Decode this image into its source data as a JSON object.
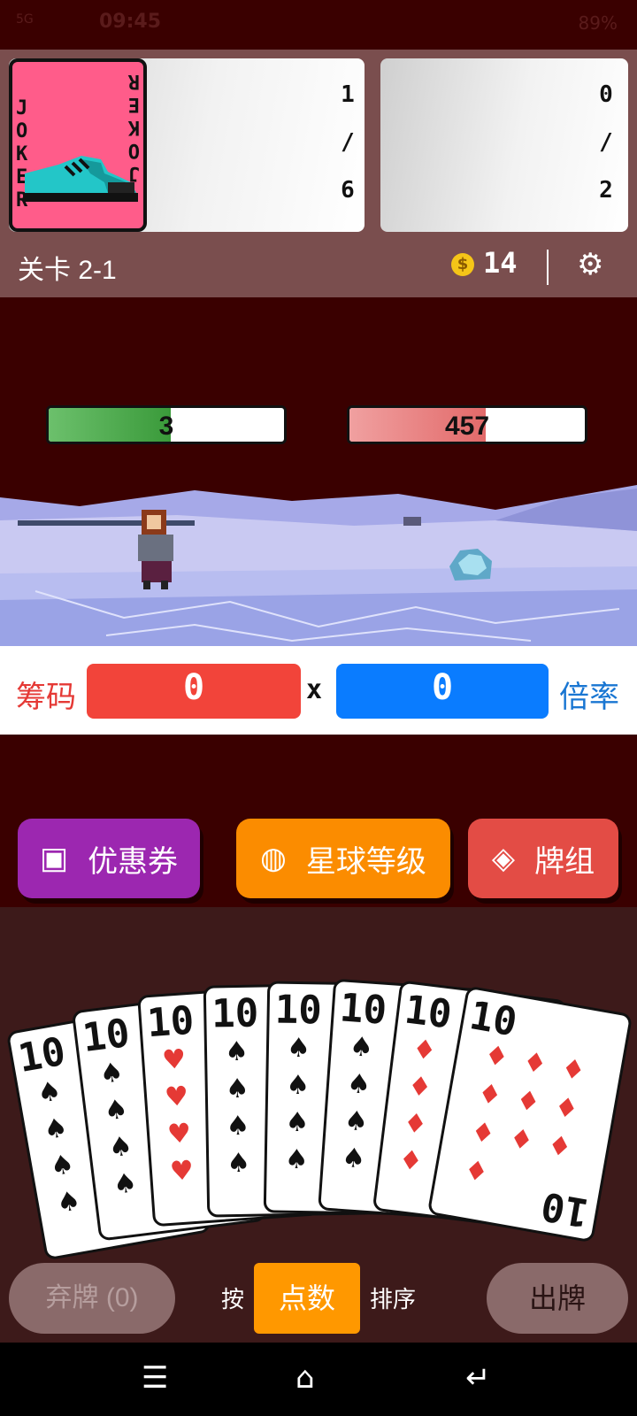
{
  "status_bar": {
    "signal": "5G",
    "time": "09:45",
    "battery": "89%"
  },
  "joker_card": {
    "name_left": "JOKER",
    "name_right": "JOKER"
  },
  "joker_slots": {
    "current": "1",
    "separator": "/",
    "max": "6"
  },
  "consumable_slots": {
    "current": "0",
    "separator": "/",
    "max": "2"
  },
  "header": {
    "level": "关卡 2-1",
    "coins": "14",
    "coin_symbol": "$"
  },
  "battle": {
    "player_hp": "3",
    "player_hp_fraction": 0.52,
    "enemy_hp": "457",
    "enemy_hp_fraction": 0.58
  },
  "score": {
    "chips_label": "筹码",
    "chips_value": "0",
    "times": "x",
    "mult_value": "0",
    "mult_label": "倍率"
  },
  "actions": {
    "coupon": "优惠券",
    "planet": "星球等级",
    "deck": "牌组"
  },
  "hand": [
    {
      "rank": "10",
      "suit": "♠",
      "color": "#111111"
    },
    {
      "rank": "10",
      "suit": "♠",
      "color": "#111111"
    },
    {
      "rank": "10",
      "suit": "♥",
      "color": "#e53935"
    },
    {
      "rank": "10",
      "suit": "♠",
      "color": "#111111"
    },
    {
      "rank": "10",
      "suit": "♠",
      "color": "#111111"
    },
    {
      "rank": "10",
      "suit": "♠",
      "color": "#111111"
    },
    {
      "rank": "10",
      "suit": "♦",
      "color": "#e53935"
    },
    {
      "rank": "10",
      "suit": "♦",
      "color": "#e53935"
    }
  ],
  "bottom": {
    "discard": "弃牌 (0)",
    "sort_by": "按",
    "sort_rank": "点数",
    "sort_label": "排序",
    "play": "出牌"
  },
  "colors": {
    "background": "#3a0000",
    "chips": "#f2443a",
    "mult": "#0a7cff",
    "coupon": "#9c27b0",
    "planet": "#fb8c00",
    "deck": "#e34c45"
  }
}
